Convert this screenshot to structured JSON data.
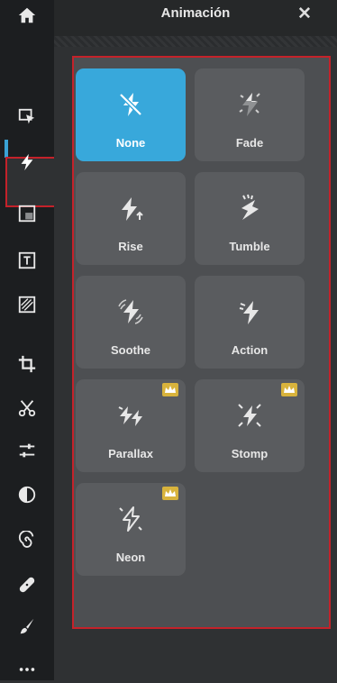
{
  "panel": {
    "title": "Animación",
    "close_label": "✕"
  },
  "rail": {
    "items": [
      {
        "icon": "home-icon"
      },
      {
        "icon": "select-cursor-icon"
      },
      {
        "icon": "animation-bolt-icon"
      },
      {
        "icon": "texture-icon"
      },
      {
        "icon": "text-box-icon"
      },
      {
        "icon": "pattern-icon"
      },
      {
        "icon": "crop-icon"
      },
      {
        "icon": "scissors-icon"
      },
      {
        "icon": "adjust-sliders-icon"
      },
      {
        "icon": "contrast-icon"
      },
      {
        "icon": "spiral-icon"
      },
      {
        "icon": "bandage-icon"
      },
      {
        "icon": "brush-icon"
      },
      {
        "icon": "more-icon"
      }
    ]
  },
  "animations": [
    {
      "label": "None",
      "selected": true,
      "premium": false,
      "icon": "none-bolt-icon"
    },
    {
      "label": "Fade",
      "selected": false,
      "premium": false,
      "icon": "fade-bolt-icon"
    },
    {
      "label": "Rise",
      "selected": false,
      "premium": false,
      "icon": "rise-bolt-icon"
    },
    {
      "label": "Tumble",
      "selected": false,
      "premium": false,
      "icon": "tumble-bolt-icon"
    },
    {
      "label": "Soothe",
      "selected": false,
      "premium": false,
      "icon": "soothe-bolt-icon"
    },
    {
      "label": "Action",
      "selected": false,
      "premium": false,
      "icon": "action-bolt-icon"
    },
    {
      "label": "Parallax",
      "selected": false,
      "premium": true,
      "icon": "parallax-bolt-icon"
    },
    {
      "label": "Stomp",
      "selected": false,
      "premium": true,
      "icon": "stomp-bolt-icon"
    },
    {
      "label": "Neon",
      "selected": false,
      "premium": true,
      "icon": "neon-bolt-icon"
    }
  ],
  "colors": {
    "accent": "#38a8db",
    "premium": "#d8b33c",
    "highlight": "#c4222a"
  }
}
